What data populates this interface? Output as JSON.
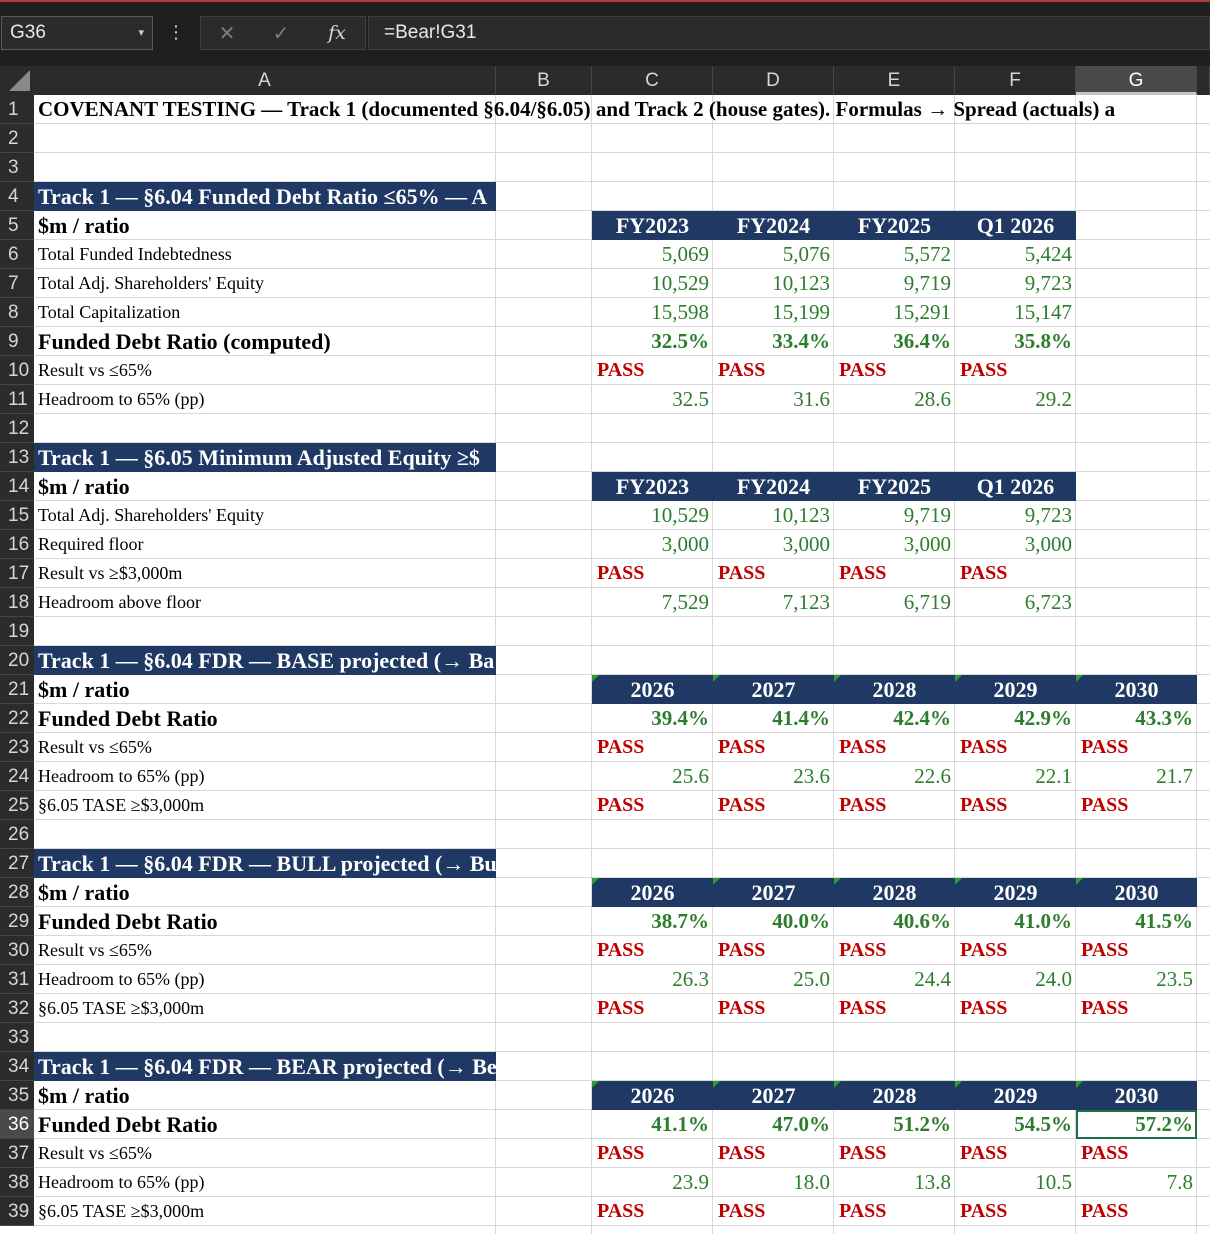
{
  "formula_bar": {
    "name_box": "G36",
    "formula": "=Bear!G31",
    "fx_label": "fx",
    "cancel_glyph": "✕",
    "enter_glyph": "✓",
    "more_glyph": "⋮",
    "dropdown_glyph": "▾"
  },
  "sheet": {
    "columns": [
      "A",
      "B",
      "C",
      "D",
      "E",
      "F",
      "G"
    ],
    "selected_column": "G",
    "selected_row": 36,
    "rows": [
      1,
      2,
      3,
      4,
      5,
      6,
      7,
      8,
      9,
      10,
      11,
      12,
      13,
      14,
      15,
      16,
      17,
      18,
      19,
      20,
      21,
      22,
      23,
      24,
      25,
      26,
      27,
      28,
      29,
      30,
      31,
      32,
      33,
      34,
      35,
      36,
      37,
      38,
      39
    ],
    "colors": {
      "section_fill": "#1f3864",
      "value_green": "#2e7d2e",
      "pass_red": "#c00000",
      "selection_green": "#1e7145"
    }
  },
  "cells": [
    {
      "r": 1,
      "c": "A",
      "style": "title",
      "text": "COVENANT TESTING — Track 1 (documented §6.04/§6.05) and Track 2 (house gates). Formulas → Spread (actuals) a"
    },
    {
      "r": 4,
      "c": "A",
      "style": "section",
      "text": "Track 1 — §6.04 Funded Debt Ratio ≤65% — A"
    },
    {
      "r": 5,
      "c": "A",
      "style": "bold",
      "text": "$m / ratio"
    },
    {
      "r": 5,
      "c": "C",
      "style": "hdr",
      "text": "FY2023"
    },
    {
      "r": 5,
      "c": "D",
      "style": "hdr",
      "text": "FY2024"
    },
    {
      "r": 5,
      "c": "E",
      "style": "hdr",
      "text": "FY2025"
    },
    {
      "r": 5,
      "c": "F",
      "style": "hdr",
      "text": "Q1 2026"
    },
    {
      "r": 6,
      "c": "A",
      "style": "label",
      "text": "Total Funded Indebtedness"
    },
    {
      "r": 6,
      "c": "C",
      "style": "num",
      "text": "5,069"
    },
    {
      "r": 6,
      "c": "D",
      "style": "num",
      "text": "5,076"
    },
    {
      "r": 6,
      "c": "E",
      "style": "num",
      "text": "5,572"
    },
    {
      "r": 6,
      "c": "F",
      "style": "num",
      "text": "5,424"
    },
    {
      "r": 7,
      "c": "A",
      "style": "label",
      "text": "Total Adj. Shareholders' Equity"
    },
    {
      "r": 7,
      "c": "C",
      "style": "num",
      "text": "10,529"
    },
    {
      "r": 7,
      "c": "D",
      "style": "num",
      "text": "10,123"
    },
    {
      "r": 7,
      "c": "E",
      "style": "num",
      "text": "9,719"
    },
    {
      "r": 7,
      "c": "F",
      "style": "num",
      "text": "9,723"
    },
    {
      "r": 8,
      "c": "A",
      "style": "label",
      "text": "Total Capitalization"
    },
    {
      "r": 8,
      "c": "C",
      "style": "num",
      "text": "15,598"
    },
    {
      "r": 8,
      "c": "D",
      "style": "num",
      "text": "15,199"
    },
    {
      "r": 8,
      "c": "E",
      "style": "num",
      "text": "15,291"
    },
    {
      "r": 8,
      "c": "F",
      "style": "num",
      "text": "15,147"
    },
    {
      "r": 9,
      "c": "A",
      "style": "bold",
      "text": "Funded Debt Ratio (computed)"
    },
    {
      "r": 9,
      "c": "C",
      "style": "numb",
      "text": "32.5%"
    },
    {
      "r": 9,
      "c": "D",
      "style": "numb",
      "text": "33.4%"
    },
    {
      "r": 9,
      "c": "E",
      "style": "numb",
      "text": "36.4%"
    },
    {
      "r": 9,
      "c": "F",
      "style": "numb",
      "text": "35.8%"
    },
    {
      "r": 10,
      "c": "A",
      "style": "label",
      "text": "Result vs ≤65%"
    },
    {
      "r": 10,
      "c": "C",
      "style": "pass",
      "text": "PASS"
    },
    {
      "r": 10,
      "c": "D",
      "style": "pass",
      "text": "PASS"
    },
    {
      "r": 10,
      "c": "E",
      "style": "pass",
      "text": "PASS"
    },
    {
      "r": 10,
      "c": "F",
      "style": "pass",
      "text": "PASS"
    },
    {
      "r": 11,
      "c": "A",
      "style": "label",
      "text": "Headroom to 65% (pp)"
    },
    {
      "r": 11,
      "c": "C",
      "style": "num",
      "text": "32.5"
    },
    {
      "r": 11,
      "c": "D",
      "style": "num",
      "text": "31.6"
    },
    {
      "r": 11,
      "c": "E",
      "style": "num",
      "text": "28.6"
    },
    {
      "r": 11,
      "c": "F",
      "style": "num",
      "text": "29.2"
    },
    {
      "r": 13,
      "c": "A",
      "style": "section",
      "text": "Track 1 — §6.05 Minimum Adjusted Equity ≥$"
    },
    {
      "r": 14,
      "c": "A",
      "style": "bold",
      "text": "$m / ratio"
    },
    {
      "r": 14,
      "c": "C",
      "style": "hdr",
      "text": "FY2023"
    },
    {
      "r": 14,
      "c": "D",
      "style": "hdr",
      "text": "FY2024"
    },
    {
      "r": 14,
      "c": "E",
      "style": "hdr",
      "text": "FY2025"
    },
    {
      "r": 14,
      "c": "F",
      "style": "hdr",
      "text": "Q1 2026"
    },
    {
      "r": 15,
      "c": "A",
      "style": "label",
      "text": "Total Adj. Shareholders' Equity"
    },
    {
      "r": 15,
      "c": "C",
      "style": "num",
      "text": "10,529"
    },
    {
      "r": 15,
      "c": "D",
      "style": "num",
      "text": "10,123"
    },
    {
      "r": 15,
      "c": "E",
      "style": "num",
      "text": "9,719"
    },
    {
      "r": 15,
      "c": "F",
      "style": "num",
      "text": "9,723"
    },
    {
      "r": 16,
      "c": "A",
      "style": "label",
      "text": "Required floor"
    },
    {
      "r": 16,
      "c": "C",
      "style": "num",
      "text": "3,000"
    },
    {
      "r": 16,
      "c": "D",
      "style": "num",
      "text": "3,000"
    },
    {
      "r": 16,
      "c": "E",
      "style": "num",
      "text": "3,000"
    },
    {
      "r": 16,
      "c": "F",
      "style": "num",
      "text": "3,000"
    },
    {
      "r": 17,
      "c": "A",
      "style": "label",
      "text": "Result vs ≥$3,000m"
    },
    {
      "r": 17,
      "c": "C",
      "style": "pass",
      "text": "PASS"
    },
    {
      "r": 17,
      "c": "D",
      "style": "pass",
      "text": "PASS"
    },
    {
      "r": 17,
      "c": "E",
      "style": "pass",
      "text": "PASS"
    },
    {
      "r": 17,
      "c": "F",
      "style": "pass",
      "text": "PASS"
    },
    {
      "r": 18,
      "c": "A",
      "style": "label",
      "text": "Headroom above floor"
    },
    {
      "r": 18,
      "c": "C",
      "style": "num",
      "text": "7,529"
    },
    {
      "r": 18,
      "c": "D",
      "style": "num",
      "text": "7,123"
    },
    {
      "r": 18,
      "c": "E",
      "style": "num",
      "text": "6,719"
    },
    {
      "r": 18,
      "c": "F",
      "style": "num",
      "text": "6,723"
    },
    {
      "r": 20,
      "c": "A",
      "style": "section",
      "text": "Track 1 — §6.04 FDR — BASE projected (→ Ba"
    },
    {
      "r": 21,
      "c": "A",
      "style": "bold",
      "text": "$m / ratio"
    },
    {
      "r": 21,
      "c": "C",
      "style": "hdr",
      "text": "2026",
      "tri": true
    },
    {
      "r": 21,
      "c": "D",
      "style": "hdr",
      "text": "2027",
      "tri": true
    },
    {
      "r": 21,
      "c": "E",
      "style": "hdr",
      "text": "2028",
      "tri": true
    },
    {
      "r": 21,
      "c": "F",
      "style": "hdr",
      "text": "2029",
      "tri": true
    },
    {
      "r": 21,
      "c": "G",
      "style": "hdr",
      "text": "2030",
      "tri": true
    },
    {
      "r": 22,
      "c": "A",
      "style": "bold",
      "text": "Funded Debt Ratio"
    },
    {
      "r": 22,
      "c": "C",
      "style": "numb",
      "text": "39.4%"
    },
    {
      "r": 22,
      "c": "D",
      "style": "numb",
      "text": "41.4%"
    },
    {
      "r": 22,
      "c": "E",
      "style": "numb",
      "text": "42.4%"
    },
    {
      "r": 22,
      "c": "F",
      "style": "numb",
      "text": "42.9%"
    },
    {
      "r": 22,
      "c": "G",
      "style": "numb",
      "text": "43.3%"
    },
    {
      "r": 23,
      "c": "A",
      "style": "label",
      "text": "Result vs ≤65%"
    },
    {
      "r": 23,
      "c": "C",
      "style": "pass",
      "text": "PASS"
    },
    {
      "r": 23,
      "c": "D",
      "style": "pass",
      "text": "PASS"
    },
    {
      "r": 23,
      "c": "E",
      "style": "pass",
      "text": "PASS"
    },
    {
      "r": 23,
      "c": "F",
      "style": "pass",
      "text": "PASS"
    },
    {
      "r": 23,
      "c": "G",
      "style": "pass",
      "text": "PASS"
    },
    {
      "r": 24,
      "c": "A",
      "style": "label",
      "text": "Headroom to 65% (pp)"
    },
    {
      "r": 24,
      "c": "C",
      "style": "num",
      "text": "25.6"
    },
    {
      "r": 24,
      "c": "D",
      "style": "num",
      "text": "23.6"
    },
    {
      "r": 24,
      "c": "E",
      "style": "num",
      "text": "22.6"
    },
    {
      "r": 24,
      "c": "F",
      "style": "num",
      "text": "22.1"
    },
    {
      "r": 24,
      "c": "G",
      "style": "num",
      "text": "21.7"
    },
    {
      "r": 25,
      "c": "A",
      "style": "label",
      "text": "§6.05 TASE ≥$3,000m"
    },
    {
      "r": 25,
      "c": "C",
      "style": "pass",
      "text": "PASS"
    },
    {
      "r": 25,
      "c": "D",
      "style": "pass",
      "text": "PASS"
    },
    {
      "r": 25,
      "c": "E",
      "style": "pass",
      "text": "PASS"
    },
    {
      "r": 25,
      "c": "F",
      "style": "pass",
      "text": "PASS"
    },
    {
      "r": 25,
      "c": "G",
      "style": "pass",
      "text": "PASS"
    },
    {
      "r": 27,
      "c": "A",
      "style": "section",
      "text": "Track 1 — §6.04 FDR — BULL projected (→ Bu"
    },
    {
      "r": 28,
      "c": "A",
      "style": "bold",
      "text": "$m / ratio"
    },
    {
      "r": 28,
      "c": "C",
      "style": "hdr",
      "text": "2026",
      "tri": true
    },
    {
      "r": 28,
      "c": "D",
      "style": "hdr",
      "text": "2027",
      "tri": true
    },
    {
      "r": 28,
      "c": "E",
      "style": "hdr",
      "text": "2028",
      "tri": true
    },
    {
      "r": 28,
      "c": "F",
      "style": "hdr",
      "text": "2029",
      "tri": true
    },
    {
      "r": 28,
      "c": "G",
      "style": "hdr",
      "text": "2030",
      "tri": true
    },
    {
      "r": 29,
      "c": "A",
      "style": "bold",
      "text": "Funded Debt Ratio"
    },
    {
      "r": 29,
      "c": "C",
      "style": "numb",
      "text": "38.7%"
    },
    {
      "r": 29,
      "c": "D",
      "style": "numb",
      "text": "40.0%"
    },
    {
      "r": 29,
      "c": "E",
      "style": "numb",
      "text": "40.6%"
    },
    {
      "r": 29,
      "c": "F",
      "style": "numb",
      "text": "41.0%"
    },
    {
      "r": 29,
      "c": "G",
      "style": "numb",
      "text": "41.5%"
    },
    {
      "r": 30,
      "c": "A",
      "style": "label",
      "text": "Result vs ≤65%"
    },
    {
      "r": 30,
      "c": "C",
      "style": "pass",
      "text": "PASS"
    },
    {
      "r": 30,
      "c": "D",
      "style": "pass",
      "text": "PASS"
    },
    {
      "r": 30,
      "c": "E",
      "style": "pass",
      "text": "PASS"
    },
    {
      "r": 30,
      "c": "F",
      "style": "pass",
      "text": "PASS"
    },
    {
      "r": 30,
      "c": "G",
      "style": "pass",
      "text": "PASS"
    },
    {
      "r": 31,
      "c": "A",
      "style": "label",
      "text": "Headroom to 65% (pp)"
    },
    {
      "r": 31,
      "c": "C",
      "style": "num",
      "text": "26.3"
    },
    {
      "r": 31,
      "c": "D",
      "style": "num",
      "text": "25.0"
    },
    {
      "r": 31,
      "c": "E",
      "style": "num",
      "text": "24.4"
    },
    {
      "r": 31,
      "c": "F",
      "style": "num",
      "text": "24.0"
    },
    {
      "r": 31,
      "c": "G",
      "style": "num",
      "text": "23.5"
    },
    {
      "r": 32,
      "c": "A",
      "style": "label",
      "text": "§6.05 TASE ≥$3,000m"
    },
    {
      "r": 32,
      "c": "C",
      "style": "pass",
      "text": "PASS"
    },
    {
      "r": 32,
      "c": "D",
      "style": "pass",
      "text": "PASS"
    },
    {
      "r": 32,
      "c": "E",
      "style": "pass",
      "text": "PASS"
    },
    {
      "r": 32,
      "c": "F",
      "style": "pass",
      "text": "PASS"
    },
    {
      "r": 32,
      "c": "G",
      "style": "pass",
      "text": "PASS"
    },
    {
      "r": 34,
      "c": "A",
      "style": "section",
      "text": "Track 1 — §6.04 FDR — BEAR projected (→ Be"
    },
    {
      "r": 35,
      "c": "A",
      "style": "bold",
      "text": "$m / ratio"
    },
    {
      "r": 35,
      "c": "C",
      "style": "hdr",
      "text": "2026",
      "tri": true
    },
    {
      "r": 35,
      "c": "D",
      "style": "hdr",
      "text": "2027",
      "tri": true
    },
    {
      "r": 35,
      "c": "E",
      "style": "hdr",
      "text": "2028",
      "tri": true
    },
    {
      "r": 35,
      "c": "F",
      "style": "hdr",
      "text": "2029",
      "tri": true
    },
    {
      "r": 35,
      "c": "G",
      "style": "hdr",
      "text": "2030",
      "tri": true
    },
    {
      "r": 36,
      "c": "A",
      "style": "bold",
      "text": "Funded Debt Ratio"
    },
    {
      "r": 36,
      "c": "C",
      "style": "numb",
      "text": "41.1%"
    },
    {
      "r": 36,
      "c": "D",
      "style": "numb",
      "text": "47.0%"
    },
    {
      "r": 36,
      "c": "E",
      "style": "numb",
      "text": "51.2%"
    },
    {
      "r": 36,
      "c": "F",
      "style": "numb",
      "text": "54.5%"
    },
    {
      "r": 36,
      "c": "G",
      "style": "numb",
      "text": "57.2%",
      "selected": true
    },
    {
      "r": 37,
      "c": "A",
      "style": "label",
      "text": "Result vs ≤65%"
    },
    {
      "r": 37,
      "c": "C",
      "style": "pass",
      "text": "PASS"
    },
    {
      "r": 37,
      "c": "D",
      "style": "pass",
      "text": "PASS"
    },
    {
      "r": 37,
      "c": "E",
      "style": "pass",
      "text": "PASS"
    },
    {
      "r": 37,
      "c": "F",
      "style": "pass",
      "text": "PASS"
    },
    {
      "r": 37,
      "c": "G",
      "style": "pass",
      "text": "PASS"
    },
    {
      "r": 38,
      "c": "A",
      "style": "label",
      "text": "Headroom to 65% (pp)"
    },
    {
      "r": 38,
      "c": "C",
      "style": "num",
      "text": "23.9"
    },
    {
      "r": 38,
      "c": "D",
      "style": "num",
      "text": "18.0"
    },
    {
      "r": 38,
      "c": "E",
      "style": "num",
      "text": "13.8"
    },
    {
      "r": 38,
      "c": "F",
      "style": "num",
      "text": "10.5"
    },
    {
      "r": 38,
      "c": "G",
      "style": "num",
      "text": "7.8"
    },
    {
      "r": 39,
      "c": "A",
      "style": "label",
      "text": "§6.05 TASE ≥$3,000m"
    },
    {
      "r": 39,
      "c": "C",
      "style": "pass",
      "text": "PASS"
    },
    {
      "r": 39,
      "c": "D",
      "style": "pass",
      "text": "PASS"
    },
    {
      "r": 39,
      "c": "E",
      "style": "pass",
      "text": "PASS"
    },
    {
      "r": 39,
      "c": "F",
      "style": "pass",
      "text": "PASS"
    },
    {
      "r": 39,
      "c": "G",
      "style": "pass",
      "text": "PASS"
    }
  ]
}
